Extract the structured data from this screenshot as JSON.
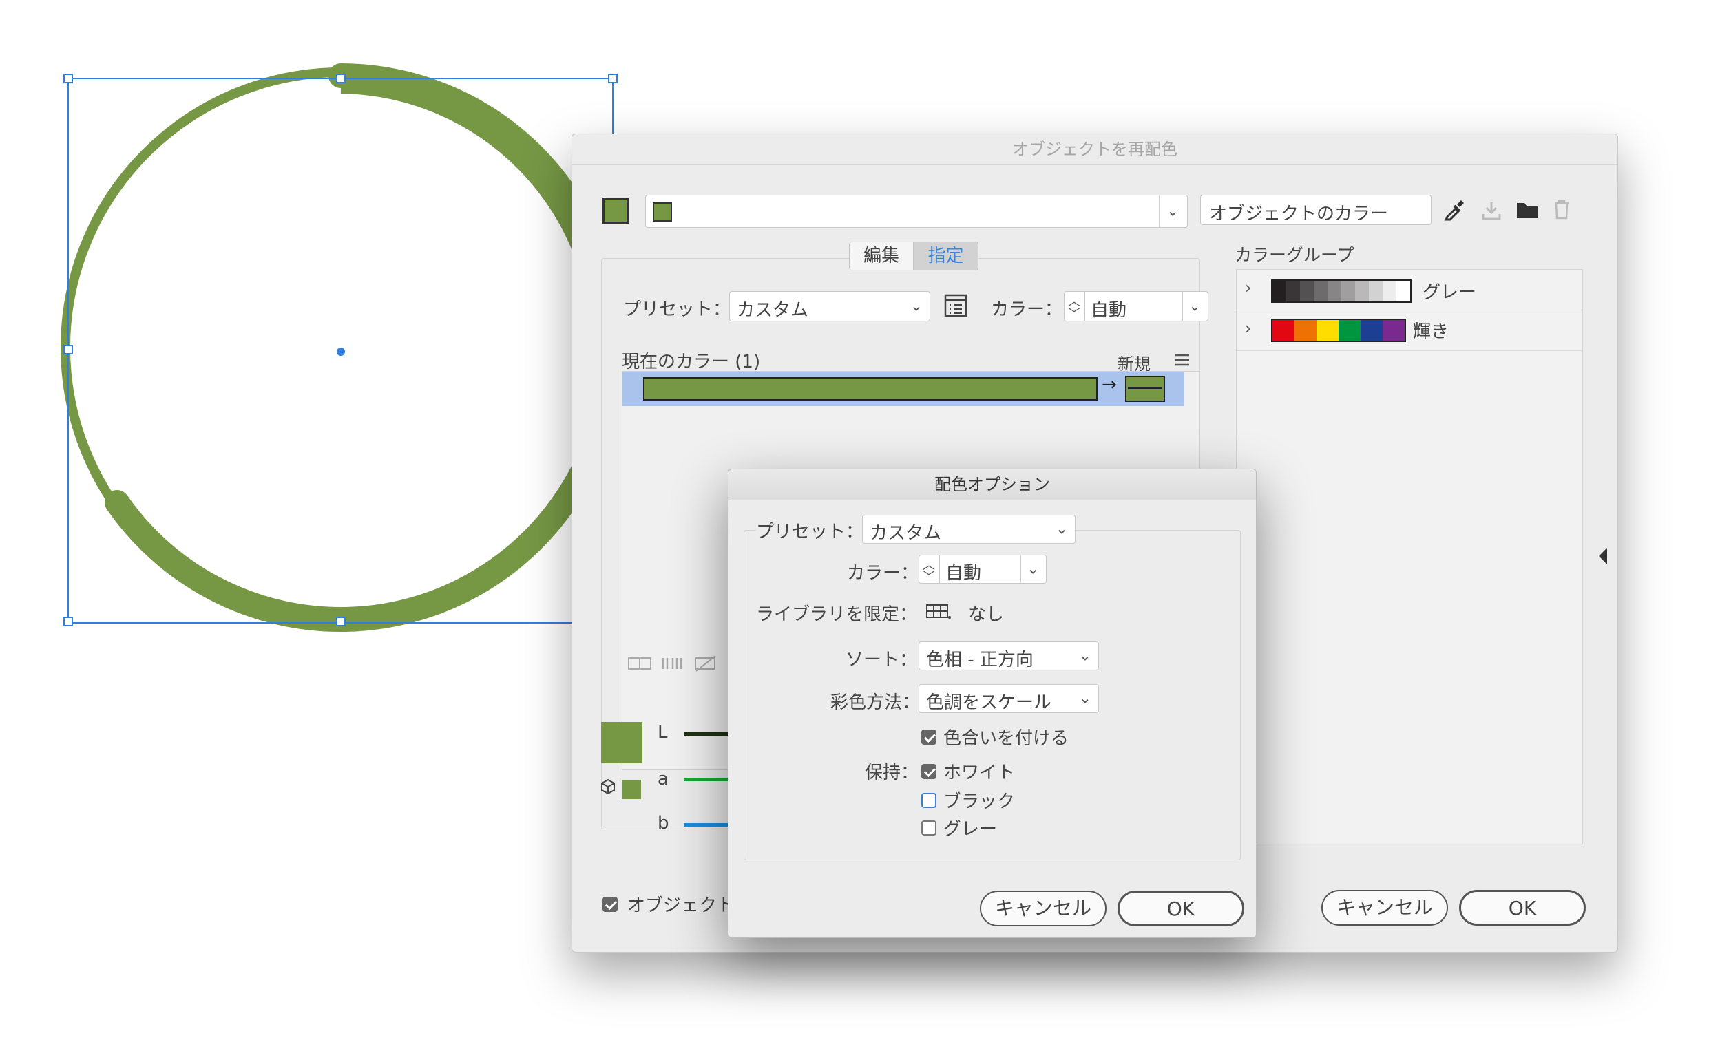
{
  "main_dialog": {
    "title": "オブジェクトを再配色",
    "color_group_select": {
      "value": "オブジェクトのカラー"
    },
    "tabs": [
      {
        "label": "編集",
        "active": false
      },
      {
        "label": "指定",
        "active": true
      }
    ],
    "preset_label": "プリセット：",
    "preset_value": "カスタム",
    "color_label": "カラー：",
    "color_value": "自動",
    "current_colors_label": "現在のカラー (1)",
    "new_label": "新規",
    "color_groups_label": "カラーグループ",
    "color_groups": [
      {
        "name": "グレー",
        "swatches": [
          "#231f20",
          "#3a3637",
          "#545152",
          "#6d6b6c",
          "#878586",
          "#a09e9f",
          "#bab8b9",
          "#d3d2d2",
          "#ededed",
          "#ffffff"
        ]
      },
      {
        "name": "輝き",
        "swatches": [
          "#e30613",
          "#ee7203",
          "#ffdd00",
          "#009640",
          "#1d3f93",
          "#7a2a8f"
        ]
      }
    ],
    "lab_labels": [
      "L",
      "a",
      "b"
    ],
    "recolor_art_label": "オブジェクト",
    "cancel_label": "キャンセル",
    "ok_label": "OK"
  },
  "options_dialog": {
    "title": "配色オプション",
    "preset_label": "プリセット：",
    "preset_value": "カスタム",
    "color_label": "カラー：",
    "color_value": "自動",
    "limit_library_label": "ライブラリを限定：",
    "limit_library_value": "なし",
    "sort_label": "ソート：",
    "sort_value": "色相 - 正方向",
    "colorize_method_label": "彩色方法：",
    "colorize_method_value": "色調をスケール",
    "combine_tints_label": "色合いを付ける",
    "combine_tints_checked": true,
    "preserve_label": "保持：",
    "preserve": [
      {
        "label": "ホワイト",
        "checked": true
      },
      {
        "label": "ブラック",
        "checked": false
      },
      {
        "label": "グレー",
        "checked": false
      }
    ],
    "cancel_label": "キャンセル",
    "ok_label": "OK"
  },
  "colors": {
    "art_green": "#769845",
    "selection_blue": "#2f7ee0",
    "row_highlight": "#a9c3ec",
    "accent_blue": "#3b84d8"
  }
}
